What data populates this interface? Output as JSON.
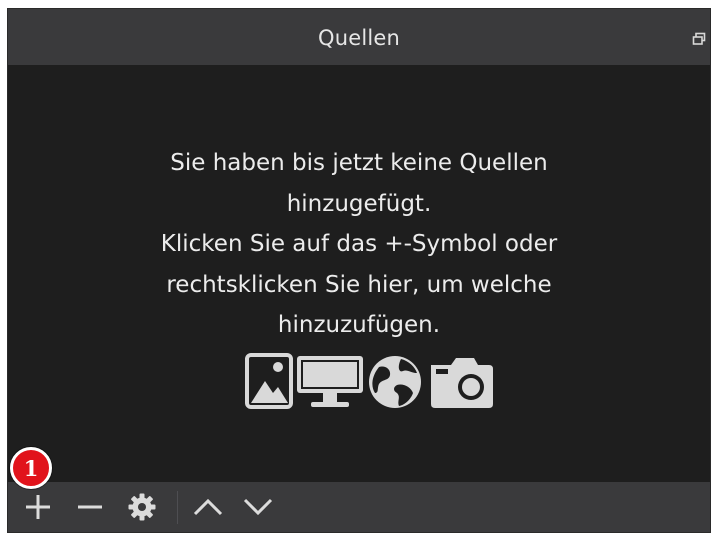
{
  "panel": {
    "title": "Quellen"
  },
  "empty_state": {
    "lines": [
      "Sie haben bis jetzt keine Quellen",
      "hinzugefügt.",
      "Klicken Sie auf das +-Symbol oder",
      "rechtsklicken Sie hier, um welche",
      "hinzuzufügen."
    ],
    "icons": [
      "image-icon",
      "monitor-icon",
      "globe-icon",
      "camera-icon"
    ]
  },
  "toolbar": {
    "buttons": [
      "add-icon",
      "remove-icon",
      "gear-icon",
      "chevron-up-icon",
      "chevron-down-icon"
    ]
  },
  "annotation": {
    "badge_label": "1"
  },
  "colors": {
    "panel_bg": "#1e1e1e",
    "bar_bg": "#3a3a3c",
    "text": "#ececec",
    "badge": "#e1131b"
  }
}
